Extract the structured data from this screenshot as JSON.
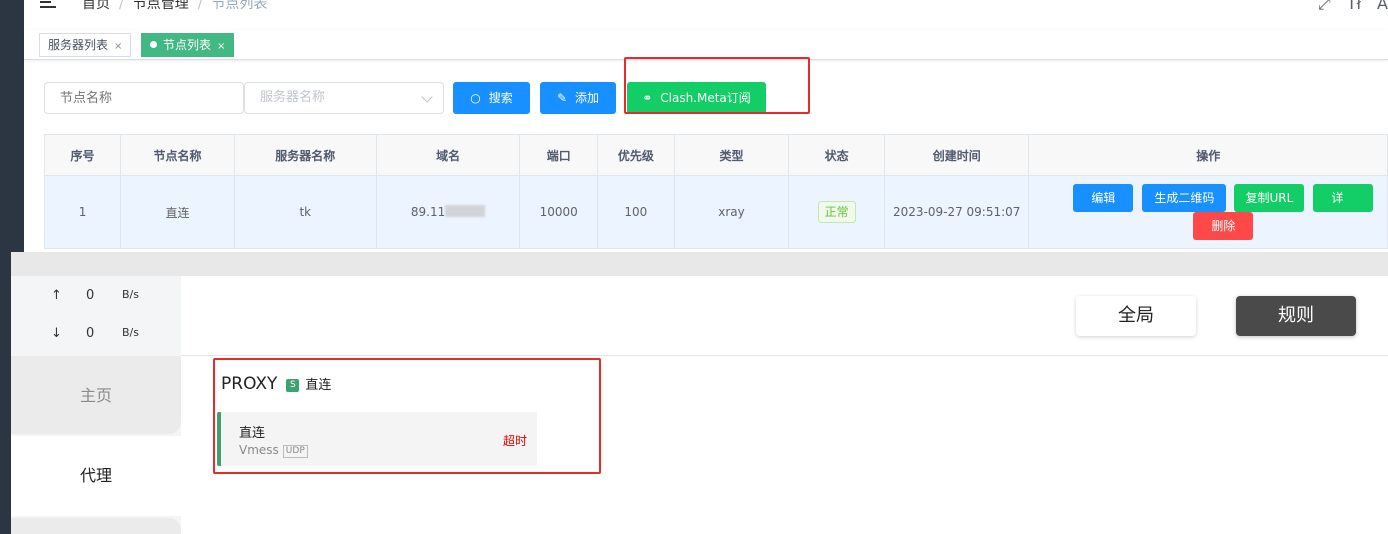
{
  "admin": {
    "breadcrumb": [
      "首页",
      "节点管理",
      "节点列表"
    ],
    "breadcrumb_sep": "/",
    "nav_icons": [
      "fullscreen-icon",
      "font-size-icon",
      "language-icon"
    ],
    "tags": [
      {
        "label": "服务器列表",
        "close": "×",
        "active": false
      },
      {
        "label": "节点列表",
        "close": "×",
        "active": true
      }
    ],
    "filters": {
      "node_name_placeholder": "节点名称",
      "server_name_placeholder": "服务器名称"
    },
    "buttons": {
      "search": "搜索",
      "add": "添加",
      "clash_meta": "Clash.Meta订阅"
    },
    "table": {
      "headers": [
        "序号",
        "节点名称",
        "服务器名称",
        "域名",
        "端口",
        "优先级",
        "类型",
        "状态",
        "创建时间",
        "操作"
      ],
      "rows": [
        {
          "index": "1",
          "node_name": "直连",
          "server_name": "tk",
          "domain": "89.11",
          "port": "10000",
          "priority": "100",
          "type": "xray",
          "status": "正常",
          "created_at": "2023-09-27 09:51:07"
        }
      ],
      "actions": [
        "编辑",
        "生成二维码",
        "复制URL",
        "详",
        "删除"
      ]
    },
    "colors": {
      "primary": "#1890ff",
      "success": "#13ce66",
      "danger": "#ff4949",
      "tag_active": "#42b983"
    }
  },
  "clash": {
    "traffic": {
      "up_arrow": "↑",
      "up_value": "0",
      "up_unit": "B/s",
      "down_arrow": "↓",
      "down_value": "0",
      "down_unit": "B/s"
    },
    "sidebar": {
      "home": "主页",
      "proxy": "代理"
    },
    "modes": {
      "global": "全局",
      "rule": "规则"
    },
    "group": {
      "name": "PROXY",
      "badge": "S",
      "selected": "直连"
    },
    "proxy_card": {
      "name": "直连",
      "protocol": "Vmess",
      "udp": "UDP",
      "latency": "超时"
    },
    "colors": {
      "selected_bar": "#3aa36f",
      "timeout": "#dd0000",
      "annotation": "#e82a2a"
    }
  }
}
